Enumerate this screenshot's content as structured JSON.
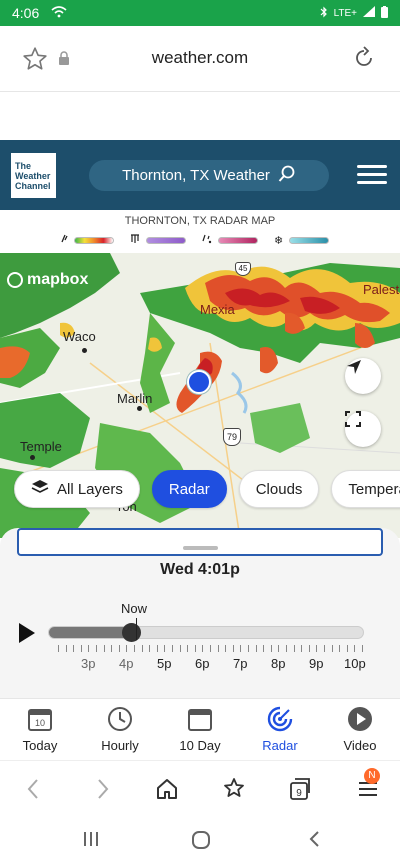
{
  "status": {
    "time": "4:06",
    "net_label": "LTE+"
  },
  "browser": {
    "url": "weather.com",
    "tab_count": "9",
    "menu_badge": "N"
  },
  "header": {
    "logo_text": "The\nWeather\nChannel",
    "search_label": "Thornton, TX Weather"
  },
  "radar": {
    "title": "THORNTON, TX RADAR MAP"
  },
  "map": {
    "attribution": "mapbox",
    "cities": [
      "Waco",
      "Marlin",
      "Temple",
      "Mexia",
      "Palestine",
      "ron"
    ],
    "highway": "79",
    "road_signs": [
      "45"
    ]
  },
  "layers": {
    "all_layers": "All Layers",
    "radar": "Radar",
    "clouds": "Clouds",
    "temperature": "Temperatu"
  },
  "timeline": {
    "current_time": "Wed 4:01p",
    "now_label": "Now",
    "progress_fraction": 0.26,
    "hours": [
      "3p",
      "4p",
      "5p",
      "6p",
      "7p",
      "8p",
      "9p",
      "10p"
    ]
  },
  "bottom_nav": {
    "items": [
      {
        "label": "Today",
        "icon": "calendar-today-icon",
        "date": "10"
      },
      {
        "label": "Hourly",
        "icon": "clock-icon"
      },
      {
        "label": "10 Day",
        "icon": "calendar-icon"
      },
      {
        "label": "Radar",
        "icon": "radar-icon"
      },
      {
        "label": "Video",
        "icon": "play-circle-icon"
      }
    ]
  },
  "colors": {
    "status_green": "#1aa34a",
    "twc_blue": "#1d4e6b",
    "accent_blue": "#1f4fe0"
  }
}
